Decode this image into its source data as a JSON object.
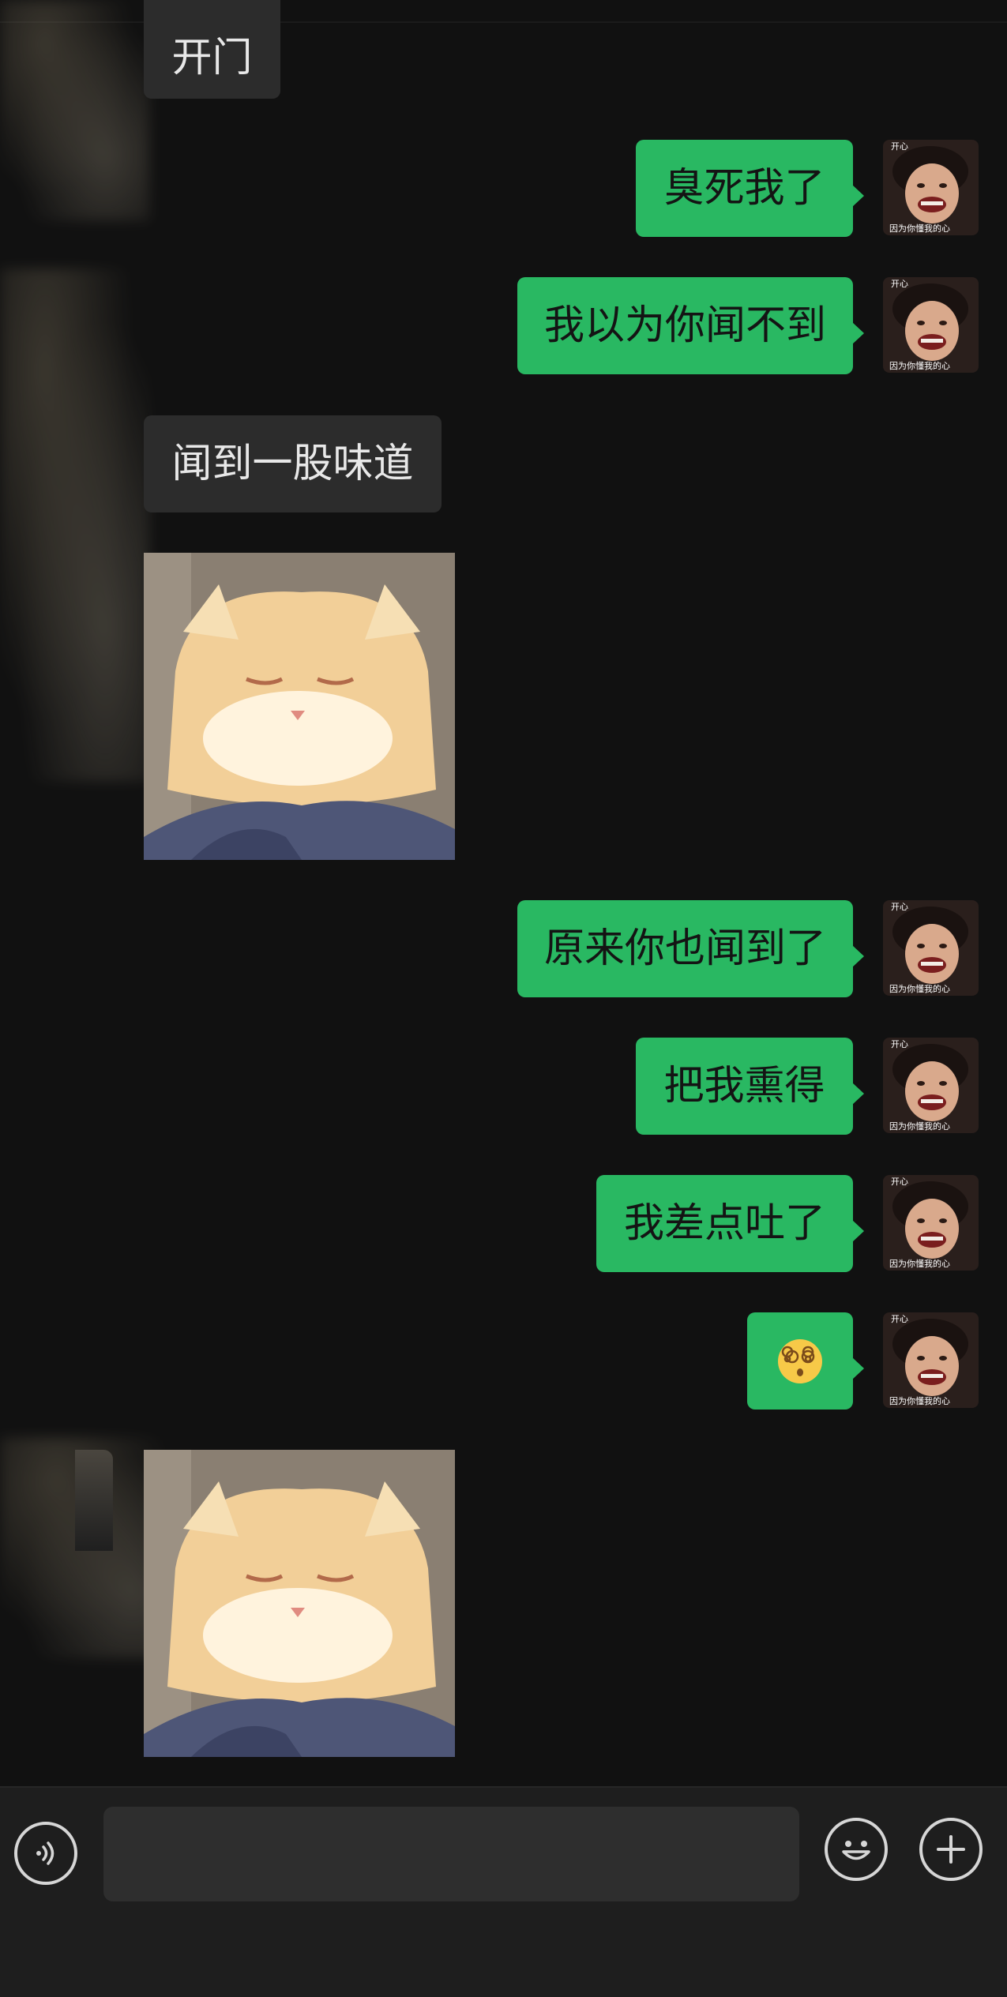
{
  "colors": {
    "background": "#111111",
    "incoming_bubble": "#2c2c2c",
    "outgoing_bubble": "#29b862",
    "bottom_bar": "#1e1e1e",
    "input_field": "#2e2e2e"
  },
  "messages": [
    {
      "direction": "incoming",
      "type": "text",
      "text": "开门"
    },
    {
      "direction": "outgoing",
      "type": "text",
      "text": "臭死我了"
    },
    {
      "direction": "outgoing",
      "type": "text",
      "text": "我以为你闻不到"
    },
    {
      "direction": "incoming",
      "type": "text",
      "text": "闻到一股味道"
    },
    {
      "direction": "incoming",
      "type": "sticker",
      "sticker": "cat-sticker"
    },
    {
      "direction": "outgoing",
      "type": "text",
      "text": "原来你也闻到了"
    },
    {
      "direction": "outgoing",
      "type": "text",
      "text": "把我熏得"
    },
    {
      "direction": "outgoing",
      "type": "text",
      "text": "我差点吐了"
    },
    {
      "direction": "outgoing",
      "type": "emoji",
      "text": "😵‍💫"
    },
    {
      "direction": "incoming",
      "type": "sticker",
      "sticker": "cat-sticker"
    }
  ],
  "avatar": {
    "top_text": "开心",
    "bottom_text": "因为你懂我的心"
  },
  "input_bar": {
    "voice_icon": "voice-icon",
    "input_value": "",
    "emoji_icon": "smiley-icon",
    "more_icon": "plus-icon"
  }
}
